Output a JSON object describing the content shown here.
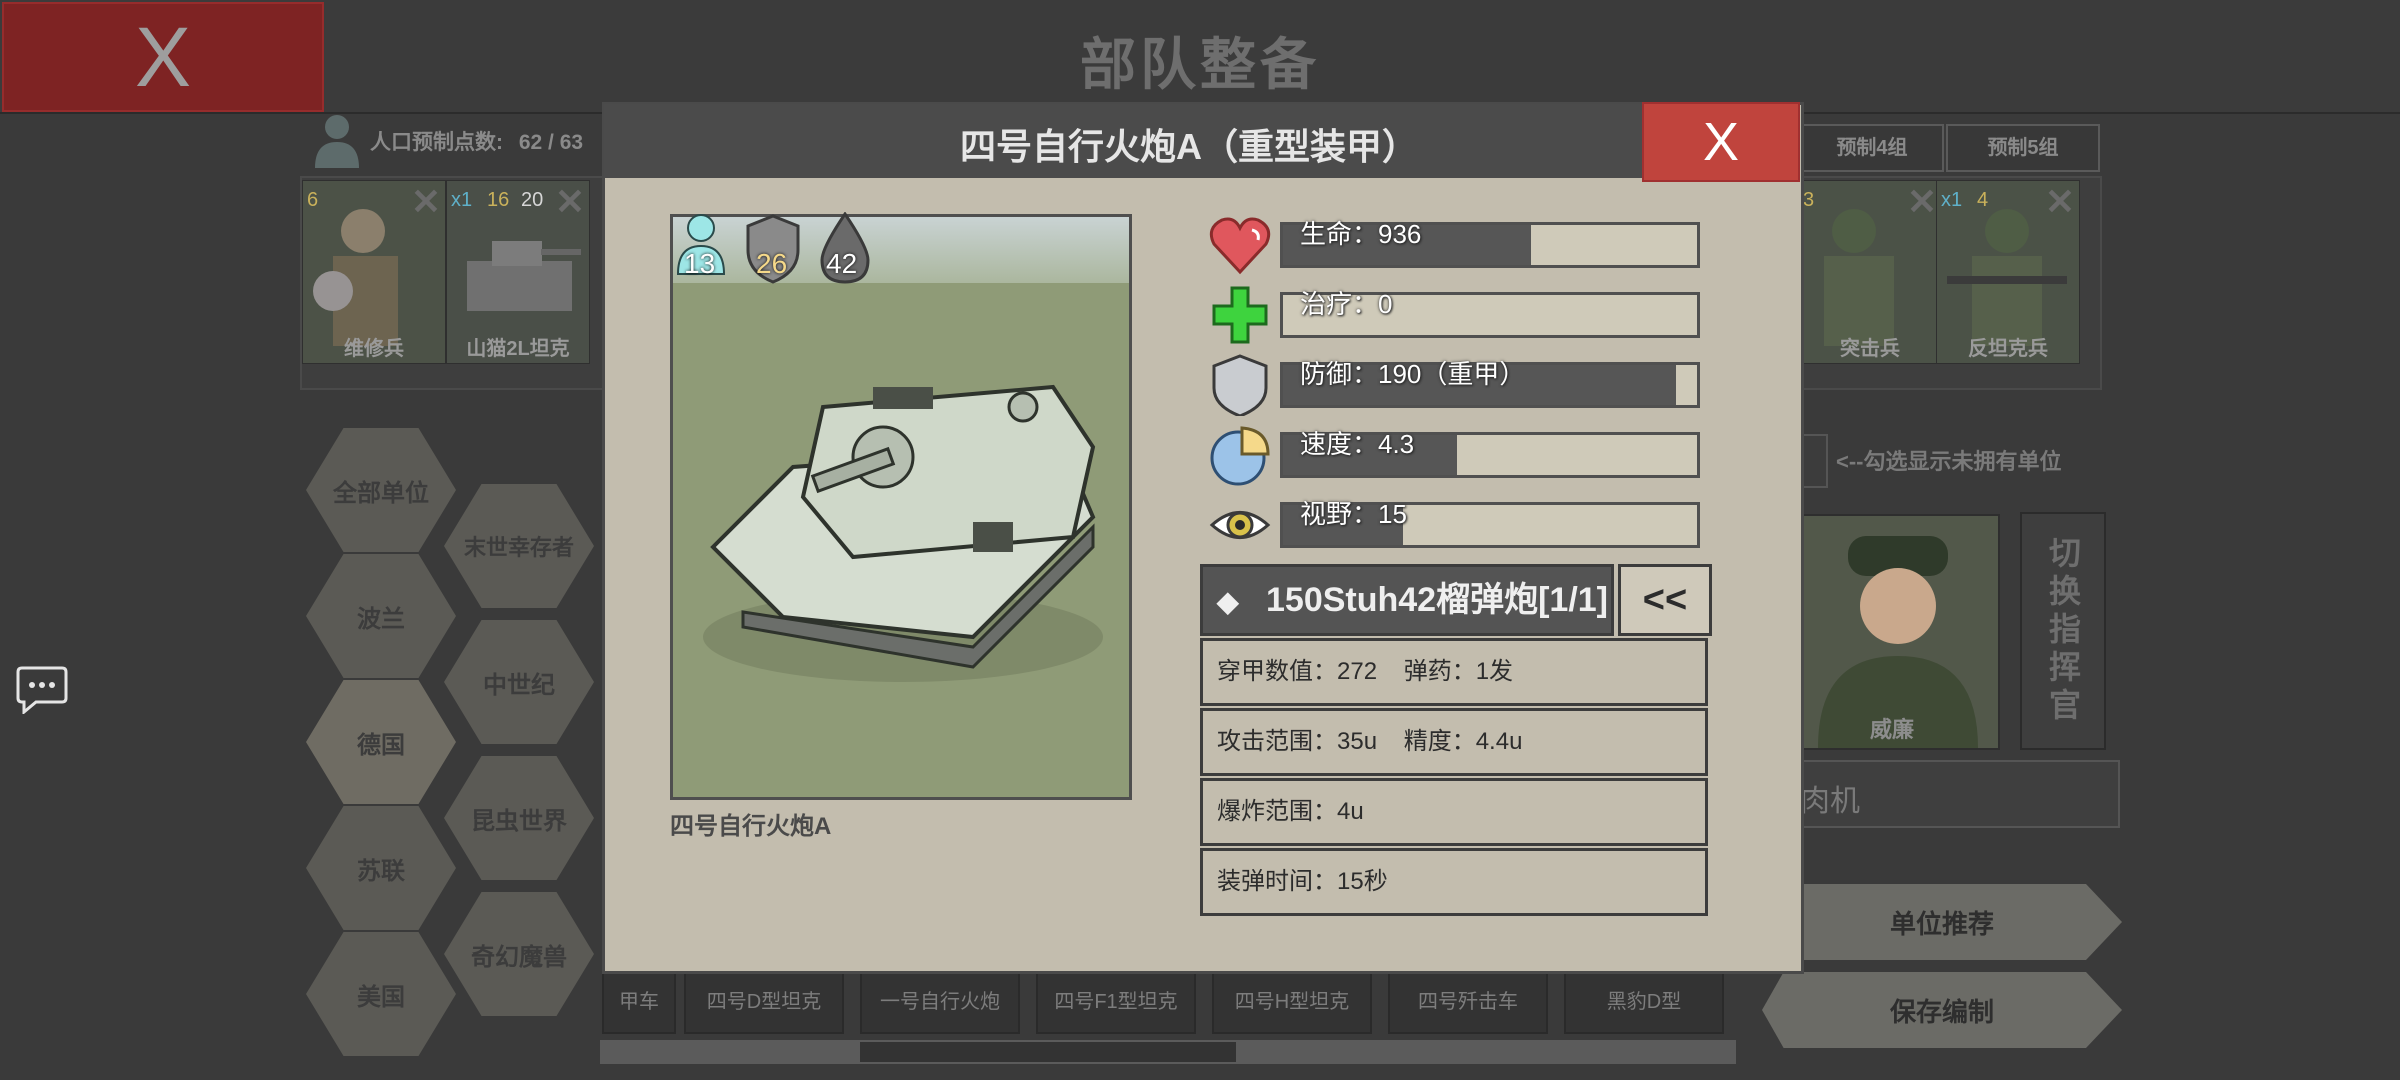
{
  "page": {
    "title": "部队整备",
    "close_label": "X"
  },
  "population": {
    "label": "人口预制点数:",
    "value": "62 / 63"
  },
  "presets": [
    {
      "label": "预制4组"
    },
    {
      "label": "预制5组"
    }
  ],
  "roster": [
    {
      "name": "维修兵",
      "badges": [
        "6"
      ]
    },
    {
      "name": "山猫2L坦克",
      "badges": [
        "x1",
        "16",
        "20"
      ]
    },
    {
      "name": "突击兵",
      "badges": [
        "3"
      ]
    },
    {
      "name": "反坦克兵",
      "badges": [
        "x1",
        "4"
      ]
    }
  ],
  "factions": [
    "全部单位",
    "波兰",
    "德国",
    "苏联",
    "美国",
    "末世幸存者",
    "中世纪",
    "昆虫世界",
    "奇幻魔兽"
  ],
  "selected_faction": "德国",
  "unowned_hint": "<--勾选显示未拥有单位",
  "commander": {
    "name": "威廉",
    "switch_label": "切换指挥官",
    "box_text": "肉机"
  },
  "actions": {
    "recommend": "单位推荐",
    "save": "保存编制"
  },
  "bottom_units": [
    "甲车",
    "四号D型坦克",
    "一号自行火炮",
    "四号F1型坦克",
    "四号H型坦克",
    "四号歼击车",
    "黑豹D型"
  ],
  "modal": {
    "title": "四号自行火炮A（重型装甲）",
    "close_label": "X",
    "unit_name": "四号自行火炮A",
    "portrait_badges": {
      "population": "13",
      "armor": "26",
      "ammo": "42"
    },
    "stats": [
      {
        "icon": "heart-icon",
        "label": "生命：936",
        "fill": 0.6
      },
      {
        "icon": "heal-icon",
        "label": "治疗：0",
        "fill": 0.0
      },
      {
        "icon": "shield-icon",
        "label": "防御：190（重甲）",
        "fill": 0.95
      },
      {
        "icon": "speed-icon",
        "label": "速度：4.3",
        "fill": 0.42
      },
      {
        "icon": "eye-icon",
        "label": "视野：15",
        "fill": 0.29
      }
    ],
    "weapon": {
      "name": "150Stuh42榴弹炮[1/1]",
      "toggle": "<<",
      "rows": [
        "穿甲数值：272    弹药：1发",
        "攻击范围：35u    精度：4.4u",
        "爆炸范围：4u",
        "装弹时间：15秒"
      ]
    }
  },
  "colors": {
    "danger": "#c0443d",
    "panel": "#c3bdae",
    "heart": "#e0575d",
    "heal": "#3ed33e"
  }
}
